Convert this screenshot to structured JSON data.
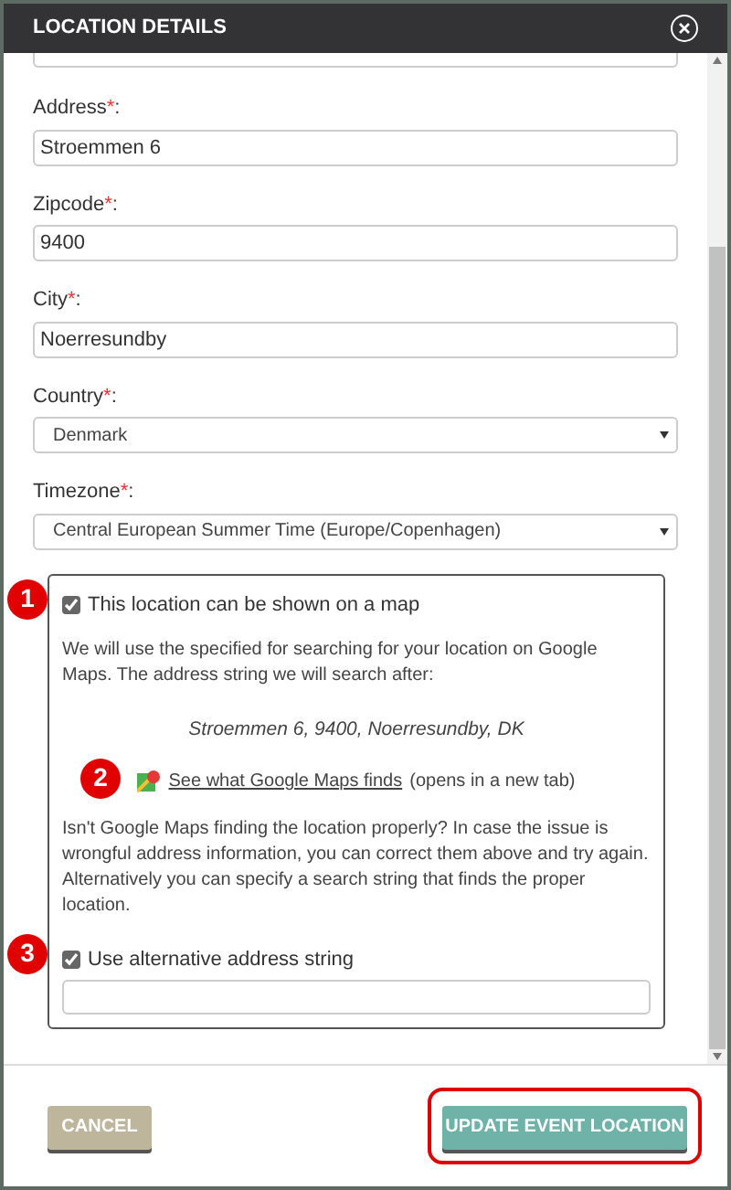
{
  "dialog": {
    "title": "LOCATION DETAILS"
  },
  "fields": [
    {
      "kind": "text",
      "label": "Address",
      "asterisk": "*",
      "colon": ":",
      "value": "Stroemmen 6"
    },
    {
      "kind": "text",
      "label": "Zipcode",
      "asterisk": "*",
      "colon": ":",
      "value": "9400"
    },
    {
      "kind": "text",
      "label": "City",
      "asterisk": "*",
      "colon": ":",
      "value": "Noerresundby"
    },
    {
      "kind": "select",
      "label": "Country",
      "asterisk": "*",
      "colon": ":",
      "value": "Denmark"
    },
    {
      "kind": "select",
      "label": "Timezone",
      "asterisk": "*",
      "colon": ":",
      "value": "Central European Summer Time (Europe/Copenhagen)"
    }
  ],
  "map_panel": {
    "show_on_map": {
      "label": "This location can be shown on a map",
      "checked": true,
      "marker": "1"
    },
    "intro": "We will use the specified for searching for your location on Google Maps. The address string we will search after:",
    "address_string": "Stroemmen 6, 9400, Noerresundby, DK",
    "link": {
      "text": "See what Google Maps finds",
      "note": "(opens in a new tab)",
      "marker": "2"
    },
    "help": "Isn't Google Maps finding the location properly? In case the issue is wrongful address information, you can correct them above and try again. Alternatively you can specify a search string that finds the proper location.",
    "alternative": {
      "label": "Use alternative address string",
      "checked": true,
      "marker": "3"
    }
  },
  "buttons": [
    {
      "kind": "cancel",
      "label": "CANCEL",
      "highlighted": false
    },
    {
      "kind": "primary",
      "label": "UPDATE EVENT LOCATION",
      "highlighted": true
    }
  ]
}
